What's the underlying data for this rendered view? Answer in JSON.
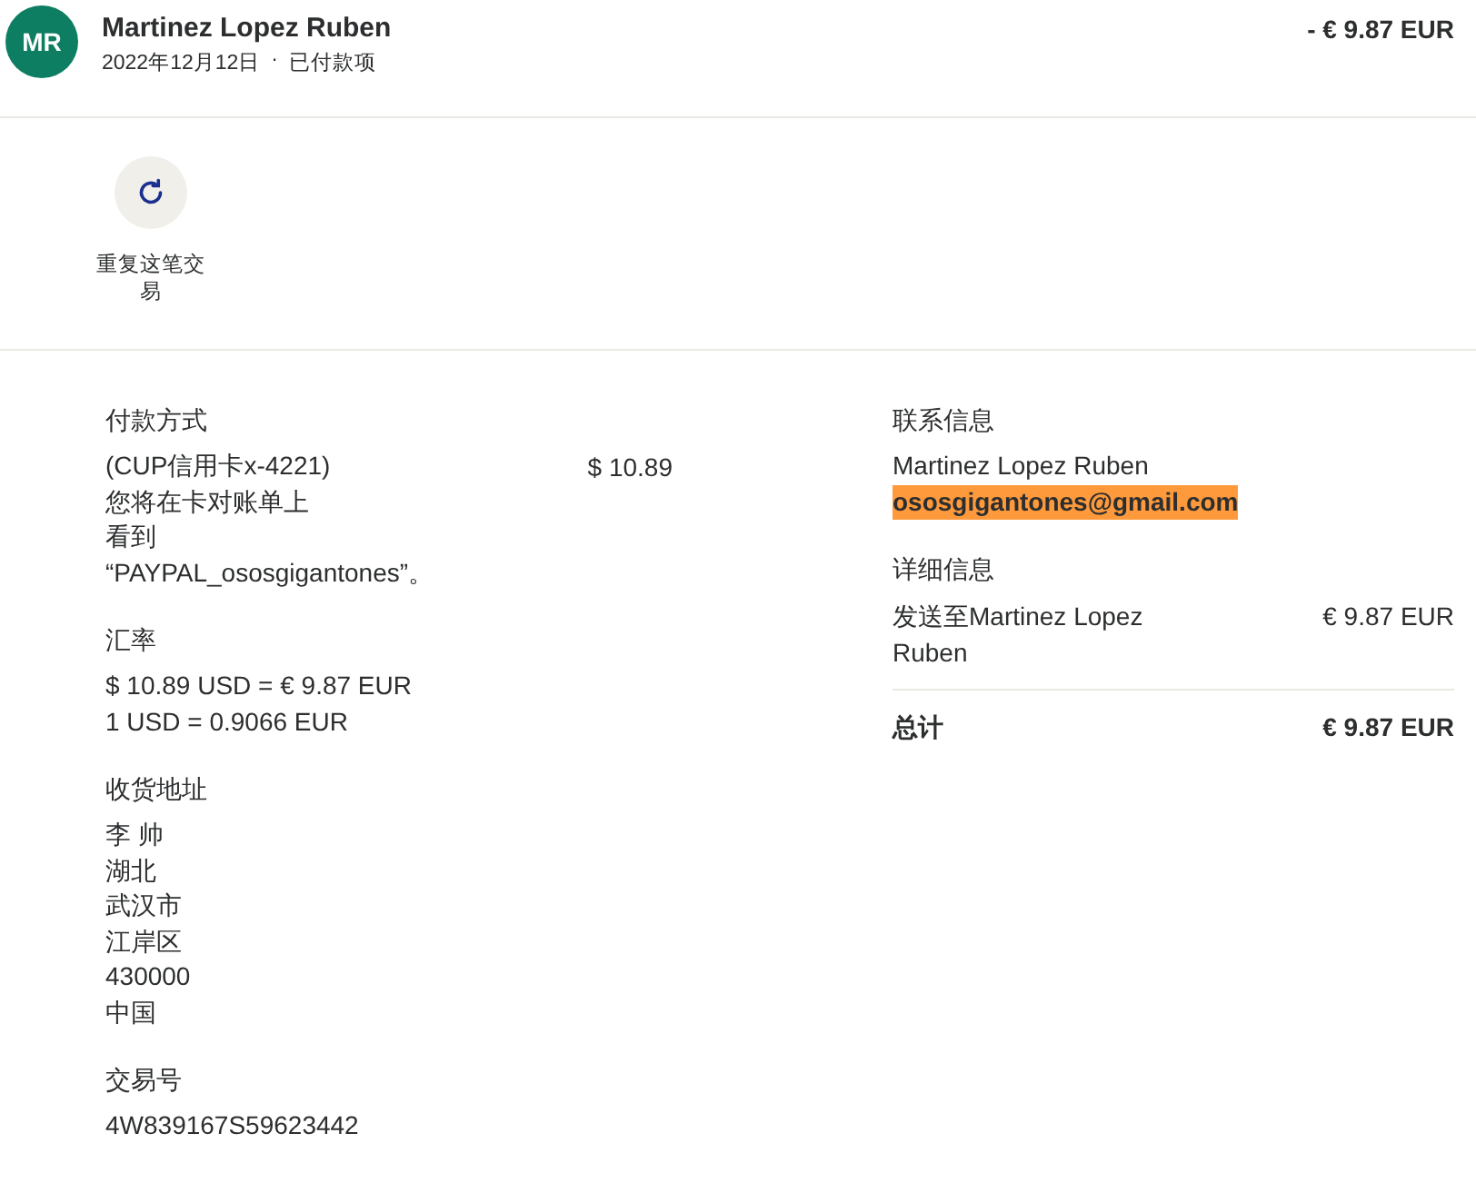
{
  "header": {
    "avatar": "MR",
    "name": "Martinez Lopez Ruben",
    "date": "2022年12月12日",
    "separator": "·",
    "status": "已付款项",
    "amount": "- € 9.87 EUR"
  },
  "actions": [
    {
      "label": "重复这笔交易"
    }
  ],
  "payment": {
    "heading": "付款方式",
    "lines": [
      "(CUP信用卡x-4221)",
      "您将在卡对账单上",
      "看到",
      "“PAYPAL_ososgigantones”。"
    ],
    "amount": "$ 10.89"
  },
  "exchange": {
    "heading": "汇率",
    "lines": [
      "$ 10.89 USD = € 9.87 EUR",
      "1 USD = 0.9066 EUR"
    ]
  },
  "shipping": {
    "heading": "收货地址",
    "lines": [
      "李 帅",
      "湖北",
      "武汉市",
      "江岸区",
      "430000",
      "中国"
    ]
  },
  "transaction": {
    "heading": "交易号",
    "id": "4W839167S59623442"
  },
  "contact": {
    "heading": "联系信息",
    "name": "Martinez Lopez Ruben",
    "email": "ososgigantones@gmail.com",
    "email_highlighted": true
  },
  "details": {
    "heading": "详细信息",
    "items": [
      {
        "label": "发送至Martinez Lopez Ruben",
        "amount": "€ 9.87 EUR"
      }
    ],
    "total_label": "总计",
    "total_amount": "€ 9.87 EUR"
  }
}
